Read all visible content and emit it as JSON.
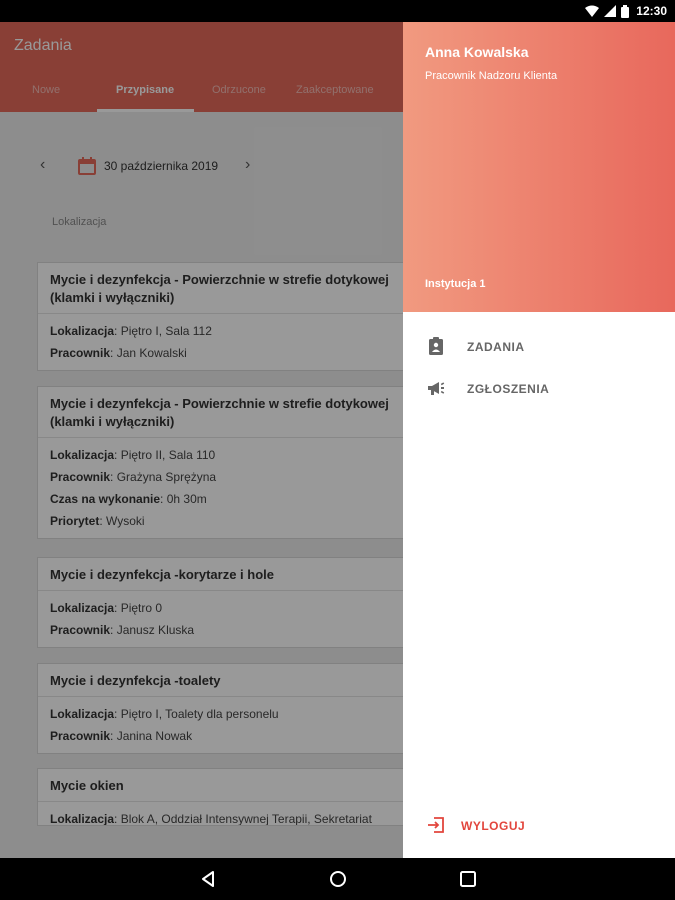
{
  "status_bar": {
    "time": "12:30"
  },
  "app": {
    "title": "Zadania",
    "tabs": [
      "Nowe",
      "Przypisane",
      "Odrzucone",
      "Zaakceptowane"
    ],
    "active_tab": "Przypisane",
    "date": "30 października 2019",
    "search_placeholder": "Lokalizacja",
    "tasks": [
      {
        "title": "Mycie i dezynfekcja - Powierzchnie w strefie dotykowej (klamki i wyłączniki)",
        "fields": [
          {
            "label": "Lokalizacja",
            "value": "Piętro I, Sala 112"
          },
          {
            "label": "Pracownik",
            "value": "Jan Kowalski"
          }
        ]
      },
      {
        "title": "Mycie i dezynfekcja - Powierzchnie w strefie dotykowej (klamki i wyłączniki)",
        "fields": [
          {
            "label": "Lokalizacja",
            "value": "Piętro II, Sala 110"
          },
          {
            "label": "Pracownik",
            "value": "Grażyna Sprężyna"
          },
          {
            "label": "Czas na wykonanie",
            "value": "0h 30m"
          },
          {
            "label": "Priorytet",
            "value": "Wysoki"
          }
        ]
      },
      {
        "title": "Mycie i dezynfekcja -korytarze i hole",
        "fields": [
          {
            "label": "Lokalizacja",
            "value": "Piętro 0"
          },
          {
            "label": "Pracownik",
            "value": "Janusz Kluska"
          }
        ]
      },
      {
        "title": "Mycie i dezynfekcja -toalety",
        "fields": [
          {
            "label": "Lokalizacja",
            "value": "Piętro I, Toalety dla personelu"
          },
          {
            "label": "Pracownik",
            "value": "Janina Nowak"
          }
        ]
      },
      {
        "title": "Mycie okien",
        "fields": [
          {
            "label": "Lokalizacja",
            "value": "Blok A, Oddział Intensywnej Terapii, Sekretariat"
          }
        ]
      }
    ]
  },
  "drawer": {
    "user_name": "Anna Kowalska",
    "user_role": "Pracownik Nadzoru Klienta",
    "institution": "Instytucja 1",
    "menu": [
      {
        "label": "ZADANIA",
        "icon": "assignment-icon"
      },
      {
        "label": "ZGŁOSZENIA",
        "icon": "megaphone-icon"
      }
    ],
    "logout_label": "WYLOGUJ"
  },
  "colors": {
    "accent": "#e4695b",
    "logout": "#e2463d"
  }
}
